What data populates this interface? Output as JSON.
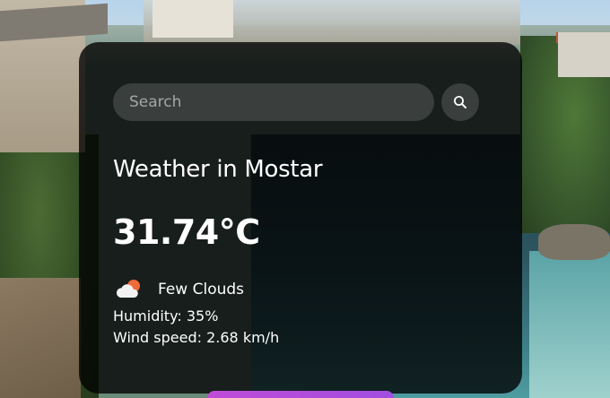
{
  "search": {
    "placeholder": "Search",
    "value": ""
  },
  "weather": {
    "title": "Weather in Mostar",
    "temperature": "31.74°C",
    "description": "Few Clouds",
    "humidity": "Humidity: 35%",
    "wind": "Wind speed: 2.68 km/h",
    "icon": "few-clouds-day-icon"
  },
  "colors": {
    "card_background": "#000000c7",
    "text": "#ffffff",
    "input_background": "#7c7c7c59",
    "accent": "#c04bd8",
    "sun": "#ef6b3a"
  }
}
